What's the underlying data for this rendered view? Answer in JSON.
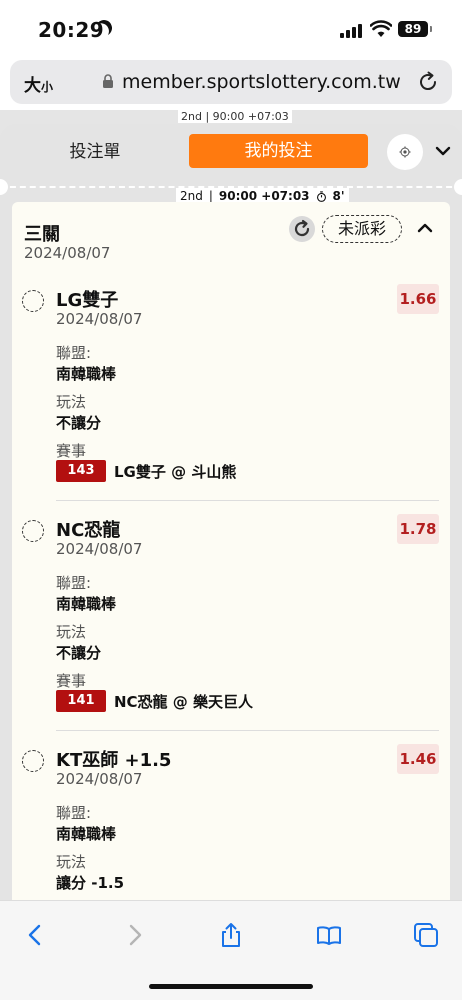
{
  "status_bar": {
    "time": "20:29",
    "battery": "89"
  },
  "browser": {
    "text_size_label": "大",
    "text_size_small": "小",
    "url": "member.sportslottery.com.tw"
  },
  "background": {
    "period": "2nd",
    "clock": "90:00 +07:03"
  },
  "tabs": {
    "bet_slip": "投注單",
    "my_bets": "我的投注"
  },
  "match_bar": {
    "period": "2nd",
    "clock": "90:00 +07:03",
    "timer": "8'"
  },
  "bet": {
    "type": "三關",
    "date": "2024/08/07",
    "status": "未派彩",
    "legs": [
      {
        "team": "LG雙子",
        "date": "2024/08/07",
        "odds": "1.66",
        "league_label": "聯盟:",
        "league": "南韓職棒",
        "market_label": "玩法",
        "market": "不讓分",
        "event_label": "賽事",
        "event_no": "143",
        "event": "LG雙子 @ 斗山熊"
      },
      {
        "team": "NC恐龍",
        "date": "2024/08/07",
        "odds": "1.78",
        "league_label": "聯盟:",
        "league": "南韓職棒",
        "market_label": "玩法",
        "market": "不讓分",
        "event_label": "賽事",
        "event_no": "141",
        "event": "NC恐龍 @ 樂天巨人"
      },
      {
        "team": "KT巫師 +1.5",
        "date": "2024/08/07",
        "odds": "1.46",
        "league_label": "聯盟:",
        "league": "南韓職棒",
        "market_label": "玩法",
        "market": "讓分 -1.5"
      }
    ]
  },
  "icons": [
    "moon-icon",
    "signal-icon",
    "wifi-icon",
    "lock-icon",
    "reload-icon",
    "gear-icon",
    "chevron-down-icon",
    "stopwatch-icon",
    "refresh-icon",
    "chevron-up-icon",
    "back-icon",
    "forward-icon",
    "share-icon",
    "bookmarks-icon",
    "tabs-icon"
  ]
}
